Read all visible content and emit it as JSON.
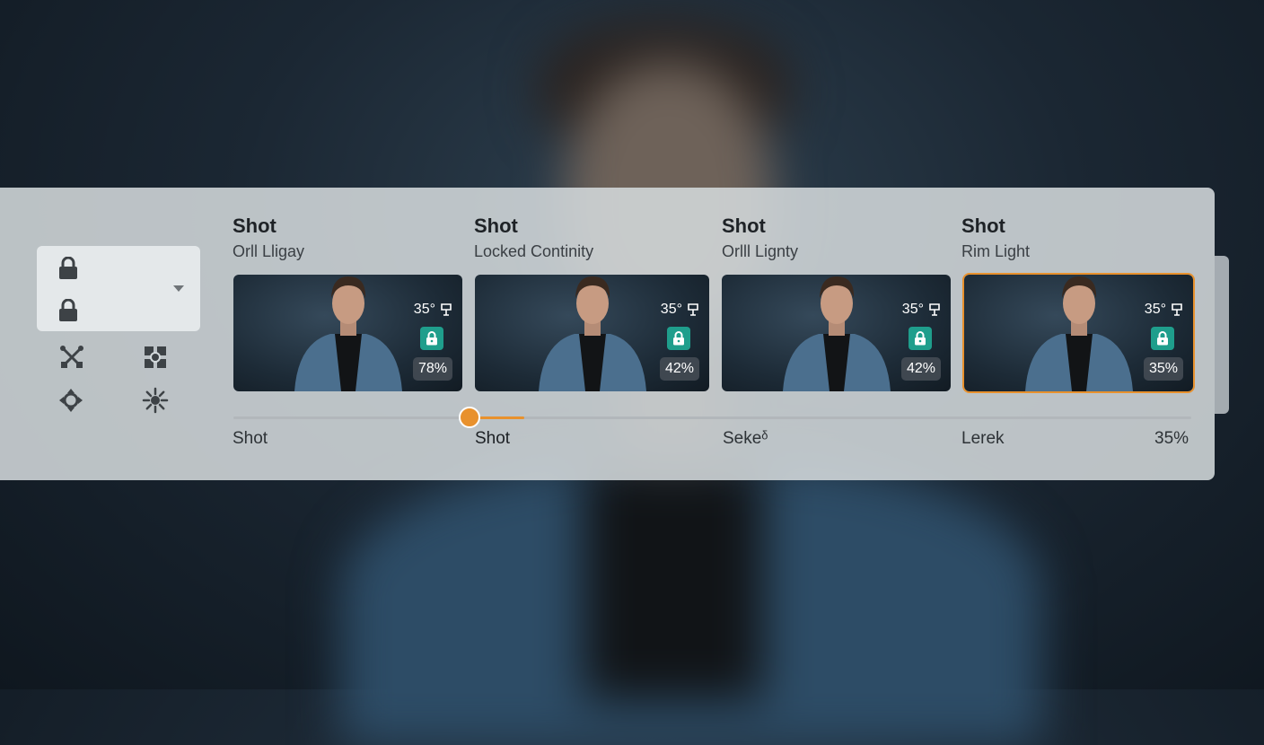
{
  "panel": {
    "lock_selector": {
      "options": [
        "lock-icon",
        "lock-icon"
      ]
    },
    "tools": [
      "crossed-tools-icon",
      "light-grid-icon",
      "spotlight-icon",
      "sun-icon"
    ]
  },
  "shots": [
    {
      "title": "Shot",
      "subtitle": "Orll Lligay",
      "angle": "35°",
      "percent": "78%",
      "selected": false
    },
    {
      "title": "Shot",
      "subtitle": "Locked Continity",
      "angle": "35°",
      "percent": "42%",
      "selected": false
    },
    {
      "title": "Shot",
      "subtitle": "Orlll Lignty",
      "angle": "35°",
      "percent": "42%",
      "selected": false
    },
    {
      "title": "Shot",
      "subtitle": "Rim Light",
      "angle": "35°",
      "percent": "35%",
      "selected": true
    }
  ],
  "timeline": {
    "labels": [
      "Shot",
      "Shot",
      "Sekeᵟ",
      "Lerek"
    ],
    "value_label": "35%",
    "accent_color": "#e8912d"
  },
  "colors": {
    "lock_badge": "#1f9e8c",
    "accent": "#e8912d"
  }
}
